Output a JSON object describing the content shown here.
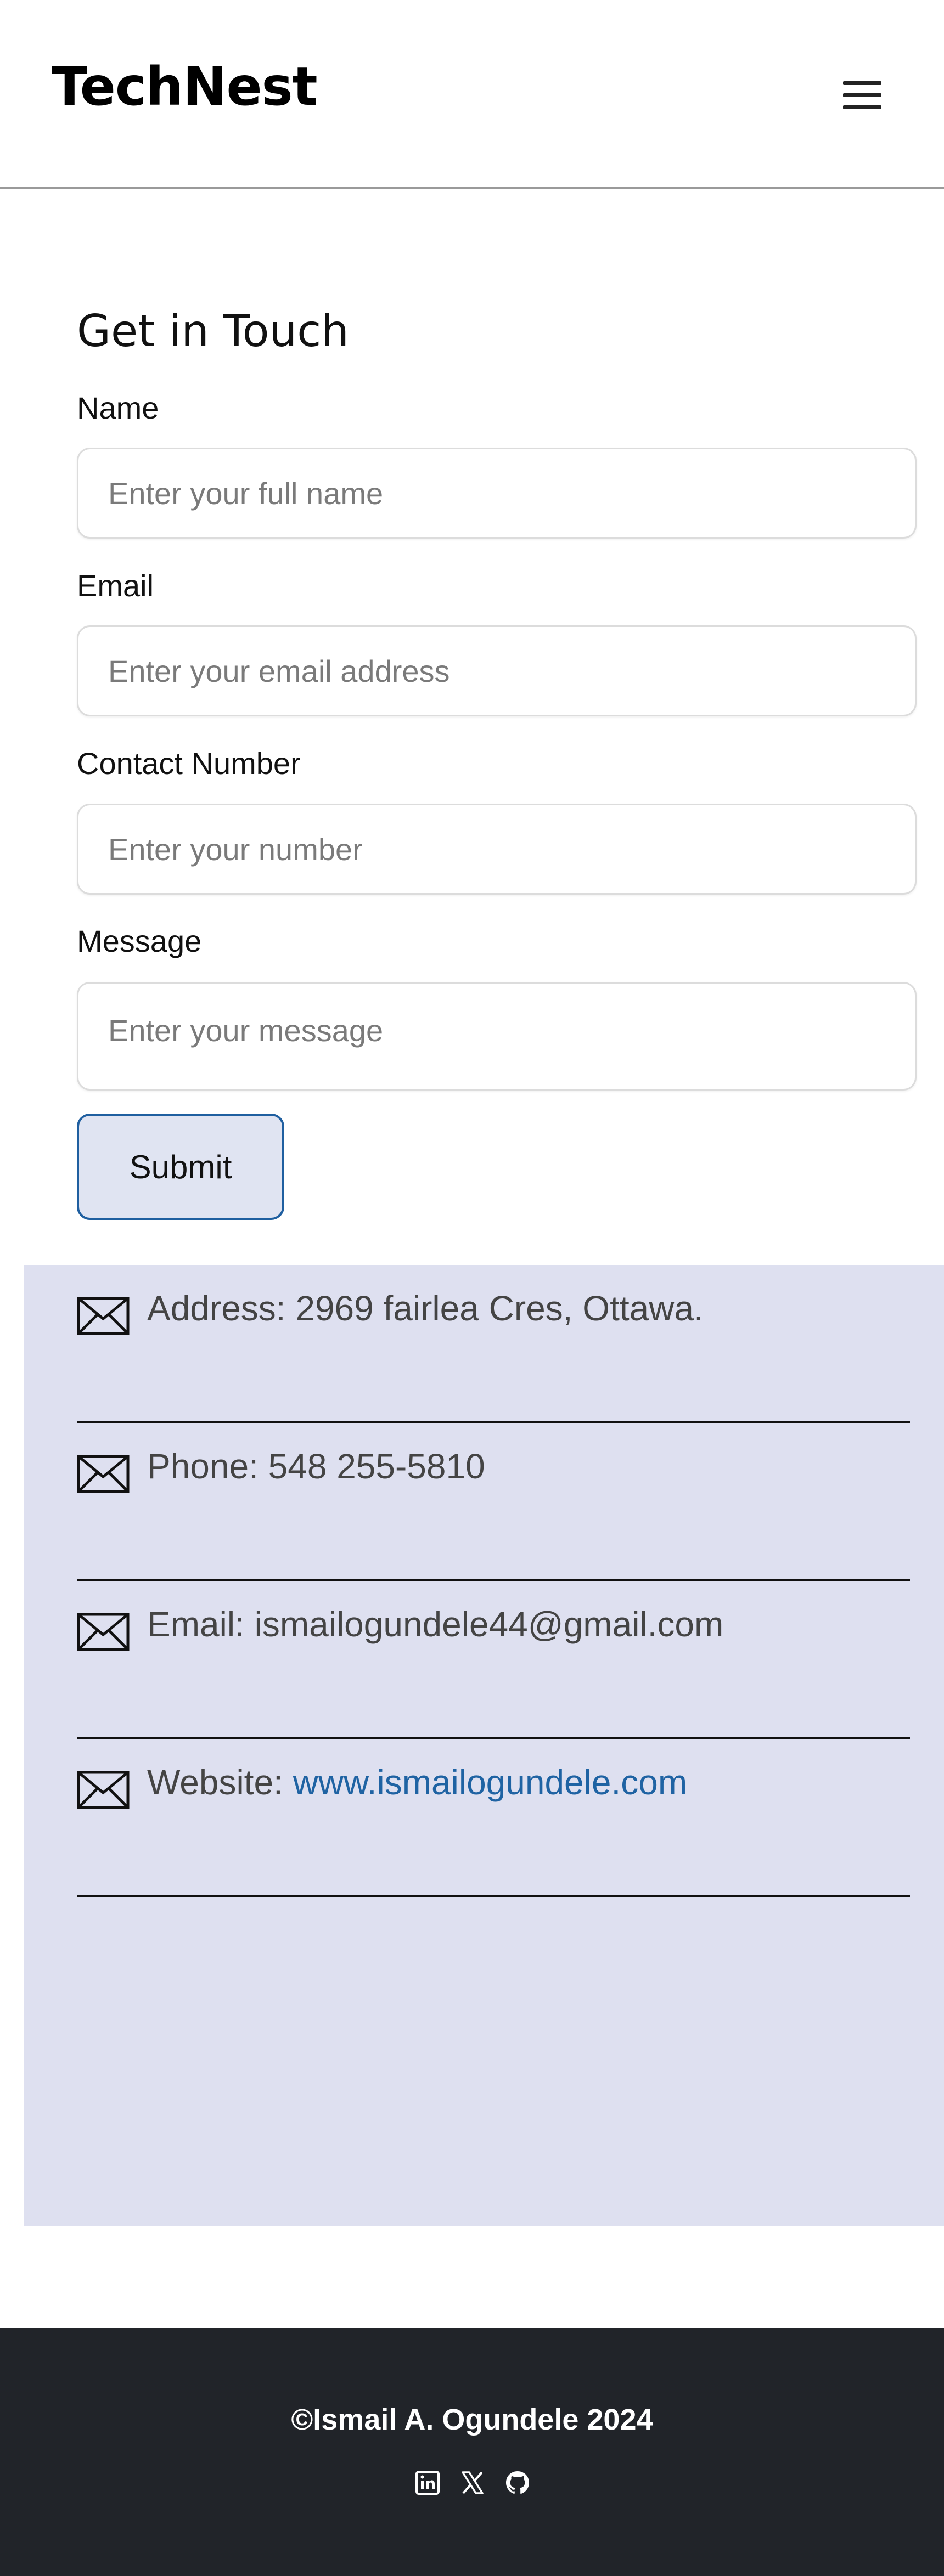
{
  "header": {
    "brand": "TechNest",
    "menu_icon": "hamburger-menu-icon"
  },
  "form": {
    "title": "Get in Touch",
    "name_label": "Name",
    "name_placeholder": "Enter your full name",
    "email_label": "Email",
    "email_placeholder": "Enter your email address",
    "contact_label": "Contact Number",
    "contact_placeholder": "Enter your number",
    "message_label": "Message",
    "message_placeholder": "Enter your message",
    "submit_label": "Submit"
  },
  "contact_info": {
    "icon": "envelope-icon",
    "address": "Address: 2969 fairlea Cres, Ottawa.",
    "phone": "Phone: 548 255-5810",
    "email": "Email: ismailogundele44@gmail.com",
    "website_prefix": "Website: ",
    "website_link": "www.ismailogundele.com"
  },
  "footer": {
    "copyright": "©Ismail A. Ogundele 2024",
    "socials": [
      "linkedin-icon",
      "x-icon",
      "github-icon"
    ]
  },
  "colors": {
    "panel_bg": "#dee0f0",
    "footer_bg": "#212429",
    "link": "#1f63a3",
    "button_border": "#1f5fa0",
    "button_bg": "#e0e4f2"
  }
}
